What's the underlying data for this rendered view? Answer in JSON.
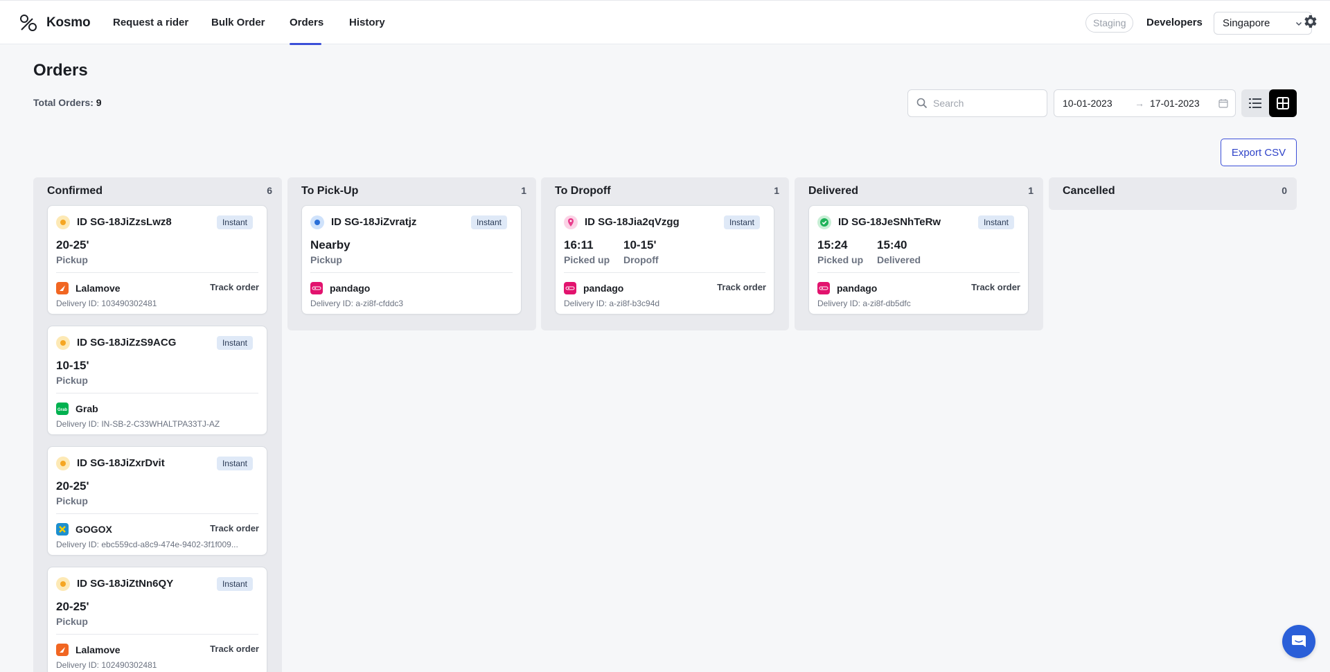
{
  "nav": {
    "brand": "Kosmo",
    "items": [
      {
        "label": "Request a rider"
      },
      {
        "label": "Bulk Order"
      },
      {
        "label": "Orders"
      },
      {
        "label": "History"
      }
    ],
    "staging": "Staging",
    "developers": "Developers",
    "country": "Singapore",
    "active": "Orders"
  },
  "page": {
    "title": "Orders",
    "total_label": "Total Orders:",
    "total_value": "9",
    "search_placeholder": "Search",
    "date_from": "10-01-2023",
    "date_arrow": "→",
    "date_to": "17-01-2023",
    "export_label": "Export CSV"
  },
  "colors": {
    "accent": "#3b4fd8",
    "badge_bg": "#dfe9f7",
    "lalamove": "#f16622",
    "grab": "#00b14f",
    "pandago": "#e2136e",
    "gogox": "#1d8fcf"
  },
  "board": {
    "columns": [
      {
        "title": "Confirmed",
        "count": "6",
        "cards": [
          {
            "id": "ID SG-18JiZzsLwz8",
            "badge": "Instant",
            "status_icon": "pending-dot-icon",
            "eta": [
              {
                "value": "20-25'",
                "label": "Pickup"
              }
            ],
            "provider": "Lalamove",
            "provider_icon": "lalamove-logo",
            "track": "Track order",
            "delivery": "Delivery ID: 103490302481"
          },
          {
            "id": "ID SG-18JiZzS9ACG",
            "badge": "Instant",
            "status_icon": "pending-dot-icon",
            "eta": [
              {
                "value": "10-15'",
                "label": "Pickup"
              }
            ],
            "provider": "Grab",
            "provider_icon": "grab-logo",
            "track": "",
            "delivery": "Delivery ID: IN-SB-2-C33WHALTPA33TJ-AZ"
          },
          {
            "id": "ID SG-18JiZxrDvit",
            "badge": "Instant",
            "status_icon": "pending-dot-icon",
            "eta": [
              {
                "value": "20-25'",
                "label": "Pickup"
              }
            ],
            "provider": "GOGOX",
            "provider_icon": "gogox-logo",
            "track": "Track order",
            "delivery": "Delivery ID: ebc559cd-a8c9-474e-9402-3f1f009..."
          },
          {
            "id": "ID SG-18JiZtNn6QY",
            "badge": "Instant",
            "status_icon": "pending-dot-icon",
            "eta": [
              {
                "value": "20-25'",
                "label": "Pickup"
              }
            ],
            "provider": "Lalamove",
            "provider_icon": "lalamove-logo",
            "track": "Track order",
            "delivery": "Delivery ID: 102490302481"
          }
        ]
      },
      {
        "title": "To Pick-Up",
        "count": "1",
        "cards": [
          {
            "id": "ID SG-18JiZvratjz",
            "badge": "Instant",
            "status_icon": "rider-dot-icon",
            "eta": [
              {
                "value": "Nearby",
                "label": "Pickup"
              }
            ],
            "provider": "pandago",
            "provider_icon": "pandago-logo",
            "track": "",
            "delivery": "Delivery ID: a-zi8f-cfddc3"
          }
        ]
      },
      {
        "title": "To Dropoff",
        "count": "1",
        "cards": [
          {
            "id": "ID SG-18Jia2qVzgg",
            "badge": "Instant",
            "status_icon": "map-pin-icon",
            "eta": [
              {
                "value": "16:11",
                "label": "Picked up"
              },
              {
                "value": "10-15'",
                "label": "Dropoff"
              }
            ],
            "provider": "pandago",
            "provider_icon": "pandago-logo",
            "track": "Track order",
            "delivery": "Delivery ID: a-zi8f-b3c94d"
          }
        ]
      },
      {
        "title": "Delivered",
        "count": "1",
        "cards": [
          {
            "id": "ID SG-18JeSNhTeRw",
            "badge": "Instant",
            "status_icon": "check-circle-icon",
            "eta": [
              {
                "value": "15:24",
                "label": "Picked up"
              },
              {
                "value": "15:40",
                "label": "Delivered"
              }
            ],
            "provider": "pandago",
            "provider_icon": "pandago-logo",
            "track": "Track order",
            "delivery": "Delivery ID: a-zi8f-db5dfc"
          }
        ]
      },
      {
        "title": "Cancelled",
        "count": "0",
        "cards": []
      }
    ]
  }
}
